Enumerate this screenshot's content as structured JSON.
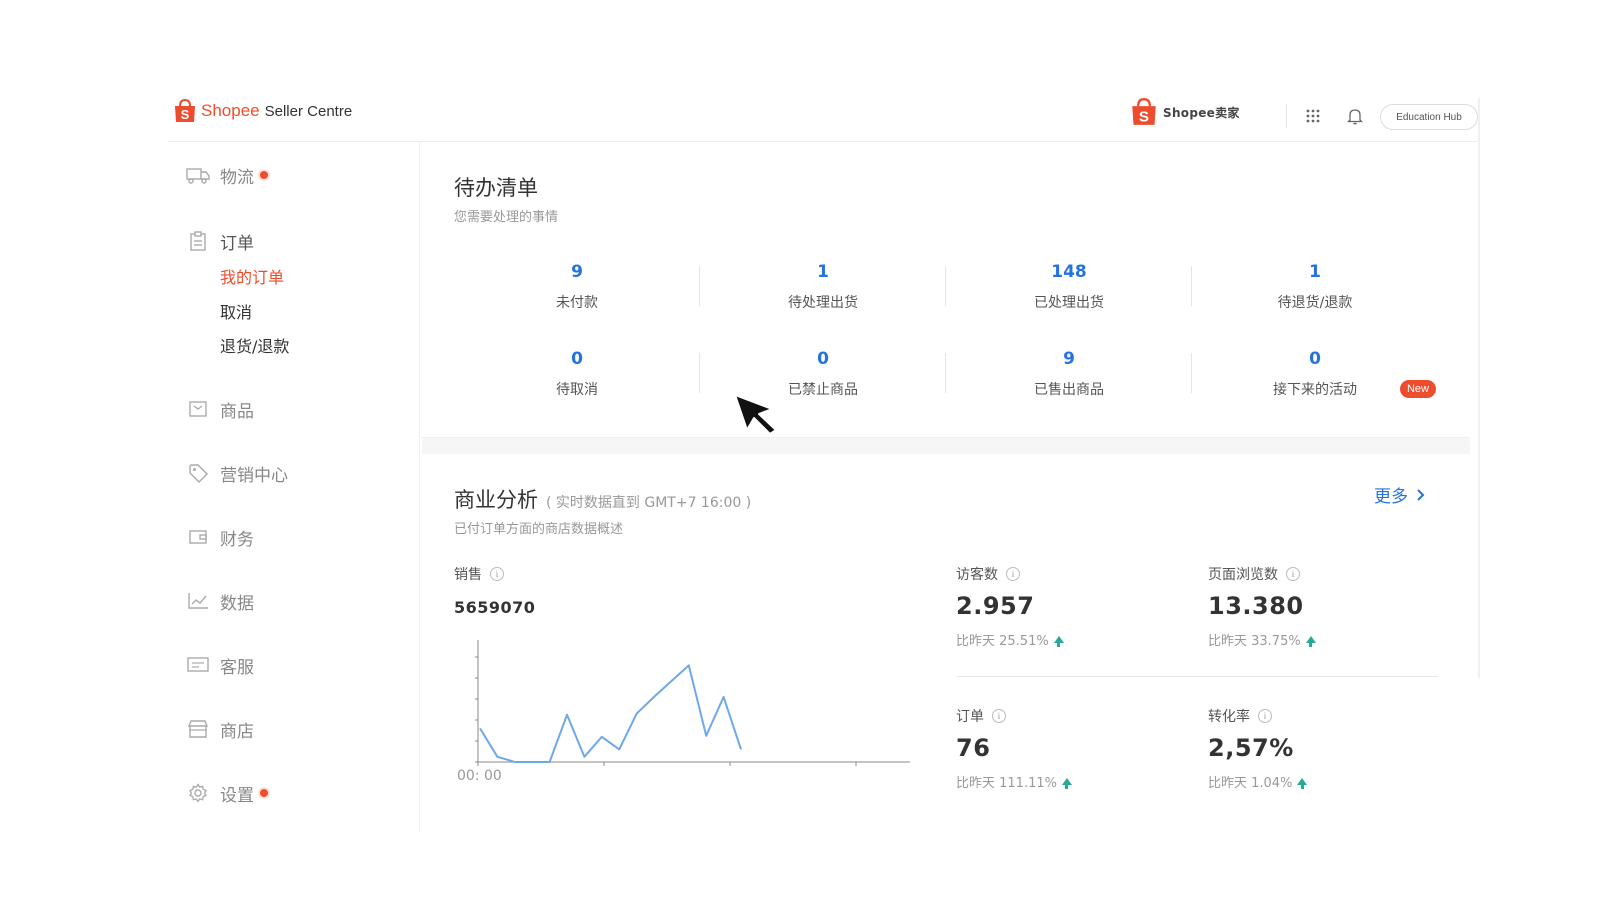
{
  "header": {
    "brand_name": "Shopee",
    "brand_sub": "Seller Centre",
    "seller_logo_text": "Shopee卖家",
    "education_hub": "Education Hub"
  },
  "sidebar": {
    "groups": [
      {
        "label": "物流",
        "icon": "truck-icon",
        "dot": true
      },
      {
        "label": "订单",
        "icon": "clipboard-icon",
        "dot": false,
        "children": [
          {
            "label": "我的订单",
            "active": true
          },
          {
            "label": "取消",
            "active": false
          },
          {
            "label": "退货/退款",
            "active": false
          }
        ]
      },
      {
        "label": "商品",
        "icon": "product-icon",
        "dot": false
      },
      {
        "label": "营销中心",
        "icon": "tag-icon",
        "dot": false
      },
      {
        "label": "财务",
        "icon": "wallet-icon",
        "dot": false
      },
      {
        "label": "数据",
        "icon": "chart-icon",
        "dot": false
      },
      {
        "label": "客服",
        "icon": "chat-icon",
        "dot": false
      },
      {
        "label": "商店",
        "icon": "shop-icon",
        "dot": false
      },
      {
        "label": "设置",
        "icon": "gear-icon",
        "dot": true
      }
    ],
    "accent_color": "#ee4d2d"
  },
  "todo": {
    "title": "待办清单",
    "subtitle": "您需要处理的事情",
    "items": [
      {
        "value": "9",
        "label": "未付款"
      },
      {
        "value": "1",
        "label": "待处理出货"
      },
      {
        "value": "148",
        "label": "已处理出货"
      },
      {
        "value": "1",
        "label": "待退货/退款"
      },
      {
        "value": "0",
        "label": "待取消"
      },
      {
        "value": "0",
        "label": "已禁止商品"
      },
      {
        "value": "9",
        "label": "已售出商品"
      },
      {
        "value": "0",
        "label": "接下来的活动"
      }
    ],
    "new_badge": "New",
    "number_color": "#2673dd"
  },
  "analysis": {
    "title": "商业分析",
    "realtime": "( 实时数据直到 GMT+7 16:00 )",
    "subtitle": "已付订单方面的商店数据概述",
    "more": "更多",
    "sales": {
      "label": "销售",
      "value": "5659070"
    },
    "metrics": {
      "visitors": {
        "label": "访客数",
        "value": "2.957",
        "cmp": "比昨天 25.51%"
      },
      "pageviews": {
        "label": "页面浏览数",
        "value": "13.380",
        "cmp": "比昨天 33.75%"
      },
      "orders": {
        "label": "订单",
        "value": "76",
        "cmp": "比昨天 111.11%"
      },
      "conversion": {
        "label": "转化率",
        "value": "2,57%",
        "cmp": "比昨天 1.04%"
      }
    },
    "up_color": "#26aa99"
  },
  "chart_data": {
    "type": "line",
    "x_tick_labels": [
      "00: 00"
    ],
    "series": [
      {
        "values": [
          0.32,
          0.05,
          0,
          0,
          0,
          0.45,
          0.05,
          0.24,
          0.12,
          0.46,
          0.62,
          0.77,
          0.92,
          0.25,
          0.62,
          0.12
        ]
      }
    ],
    "line_color": "#6fa8e8",
    "grid": false
  }
}
